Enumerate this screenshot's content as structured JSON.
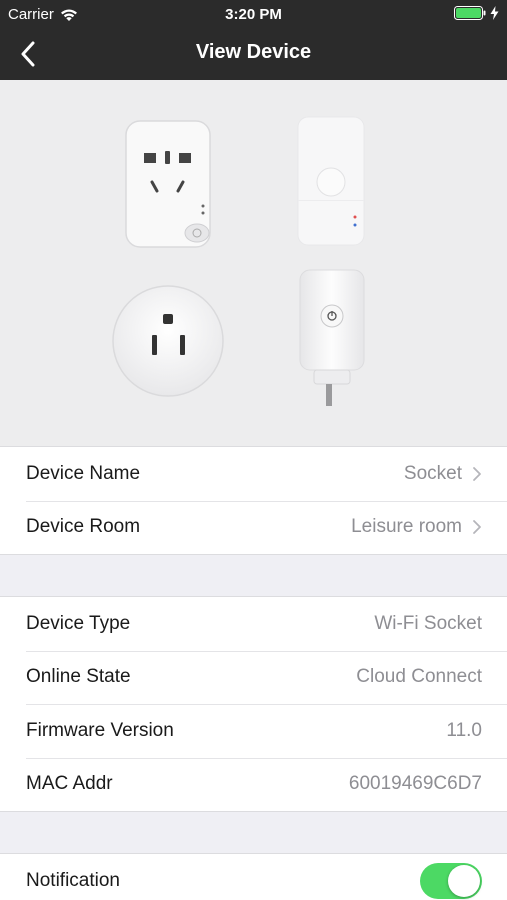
{
  "status_bar": {
    "carrier": "Carrier",
    "time": "3:20 PM"
  },
  "nav": {
    "title": "View Device",
    "back_icon": "chevron-left-icon"
  },
  "hero": {
    "description_icon": "smart-sockets-image"
  },
  "device_info": [
    {
      "label": "Device Name",
      "value": "Socket"
    },
    {
      "label": "Device Room",
      "value": "Leisure room"
    }
  ],
  "device_details": [
    {
      "label": "Device Type",
      "value": "Wi-Fi Socket"
    },
    {
      "label": "Online State",
      "value": "Cloud Connect"
    },
    {
      "label": "Firmware Version",
      "value": "11.0"
    },
    {
      "label": "MAC Addr",
      "value": "60019469C6D7"
    }
  ],
  "notification": {
    "label": "Notification",
    "enabled": true
  },
  "colors": {
    "nav_bg": "#2b2b2b",
    "toggle_on": "#4cd964",
    "battery": "#4cd964"
  }
}
